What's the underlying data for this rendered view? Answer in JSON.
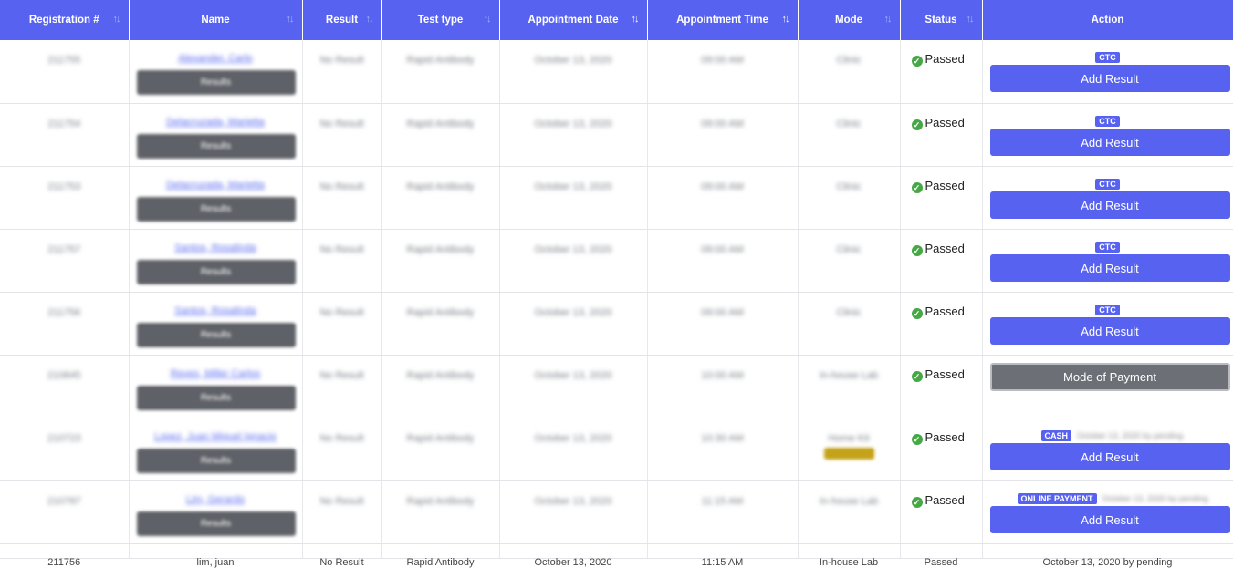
{
  "table": {
    "columns": [
      {
        "label": "Registration #",
        "sort": "both"
      },
      {
        "label": "Name",
        "sort": "both"
      },
      {
        "label": "Result",
        "sort": "both"
      },
      {
        "label": "Test type",
        "sort": "both"
      },
      {
        "label": "Appointment Date",
        "sort": "up"
      },
      {
        "label": "Appointment Time",
        "sort": "up"
      },
      {
        "label": "Mode",
        "sort": "both"
      },
      {
        "label": "Status",
        "sort": "both"
      },
      {
        "label": "Action",
        "sort": "none"
      }
    ],
    "sort_icon": "↑↓",
    "rows": [
      {
        "reg": "211755",
        "name": "Alexander, Carlo",
        "results_button": "Results",
        "result": "No Result",
        "test": "Rapid Antibody",
        "date": "October 13, 2020",
        "time": "09:00 AM",
        "mode": "Clinic",
        "status": "Passed",
        "action_type": "ctc",
        "badge": "CTC",
        "button": "Add Result"
      },
      {
        "reg": "211754",
        "name": "Delacruzada, Marietta",
        "results_button": "Results",
        "result": "No Result",
        "test": "Rapid Antibody",
        "date": "October 13, 2020",
        "time": "09:00 AM",
        "mode": "Clinic",
        "status": "Passed",
        "action_type": "ctc",
        "badge": "CTC",
        "button": "Add Result"
      },
      {
        "reg": "211753",
        "name": "Delacruzada, Marietta",
        "results_button": "Results",
        "result": "No Result",
        "test": "Rapid Antibody",
        "date": "October 13, 2020",
        "time": "09:00 AM",
        "mode": "Clinic",
        "status": "Passed",
        "action_type": "ctc",
        "badge": "CTC",
        "button": "Add Result"
      },
      {
        "reg": "211757",
        "name": "Santos, Rosalinda",
        "results_button": "Results",
        "result": "No Result",
        "test": "Rapid Antibody",
        "date": "October 13, 2020",
        "time": "09:00 AM",
        "mode": "Clinic",
        "status": "Passed",
        "action_type": "ctc",
        "badge": "CTC",
        "button": "Add Result"
      },
      {
        "reg": "211756",
        "name": "Santos, Rosalinda",
        "results_button": "Results",
        "result": "No Result",
        "test": "Rapid Antibody",
        "date": "October 13, 2020",
        "time": "09:00 AM",
        "mode": "Clinic",
        "status": "Passed",
        "action_type": "ctc",
        "badge": "CTC",
        "button": "Add Result"
      },
      {
        "reg": "210845",
        "name": "Reyes, Miller Carlos",
        "results_button": "Results",
        "result": "No Result",
        "test": "Rapid Antibody",
        "date": "October 13, 2020",
        "time": "10:00 AM",
        "mode": "In-house Lab",
        "status": "Passed",
        "action_type": "mop",
        "button": "Mode of Payment"
      },
      {
        "reg": "210723",
        "name": "Lopez, Juan Miguel Ignacio",
        "results_button": "Results",
        "result": "No Result",
        "test": "Rapid Antibody",
        "date": "October 13, 2020",
        "time": "10:30 AM",
        "mode": "Home Kit",
        "mode_badge": "gold",
        "status": "Passed",
        "action_type": "cash",
        "badge": "CASH",
        "note": "October 13, 2020 by pending",
        "button": "Add Result"
      },
      {
        "reg": "210787",
        "name": "Lim, Gerardo",
        "results_button": "Results",
        "result": "No Result",
        "test": "Rapid Antibody",
        "date": "October 13, 2020",
        "time": "11:15 AM",
        "mode": "In-house Lab",
        "status": "Passed",
        "action_type": "online",
        "badge": "ONLINE PAYMENT",
        "note": "October 13, 2020 by pending",
        "button": "Add Result"
      }
    ],
    "partial_row": {
      "reg": "211756",
      "name": "lim, juan",
      "result": "No Result",
      "test": "Rapid Antibody",
      "date": "October 13, 2020",
      "time": "11:15 AM",
      "mode": "In-house Lab",
      "status": "Passed",
      "note": "October 13, 2020 by pending"
    }
  },
  "colors": {
    "header_bg": "#5763f0",
    "primary": "#5763f0",
    "secondary": "#6c6f75",
    "success": "#45a845"
  }
}
